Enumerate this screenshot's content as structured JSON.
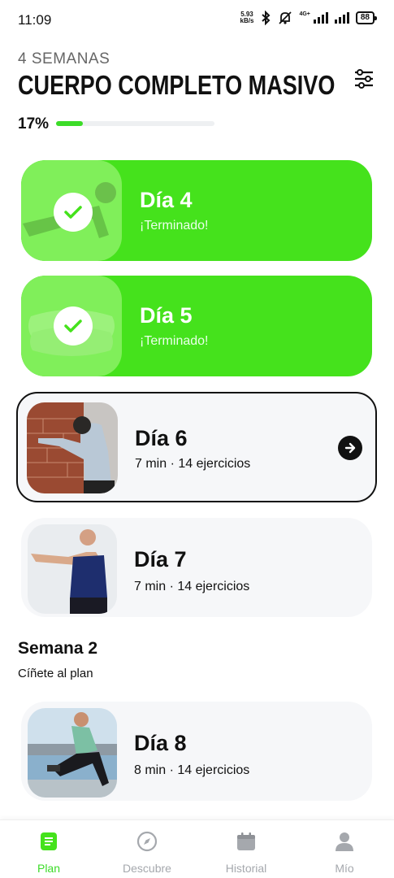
{
  "status_bar": {
    "time": "11:09",
    "net_speed_value": "5.93",
    "net_speed_unit": "kB/s",
    "network_type": "4G+",
    "battery": "88"
  },
  "header": {
    "weeks_label": "4 SEMANAS",
    "title": "CUERPO COMPLETO MASIVO",
    "progress_text": "17%",
    "progress_value": 0.17,
    "filter_icon": "sliders-icon"
  },
  "days": [
    {
      "label": "Día 4",
      "status": "¡Terminado!"
    },
    {
      "label": "Día 5",
      "status": "¡Terminado!"
    },
    {
      "label": "Día 6",
      "details": "7 min · 14 ejercicios"
    },
    {
      "label": "Día 7",
      "details": "7 min · 14 ejercicios"
    }
  ],
  "week2": {
    "title": "Semana 2",
    "subtitle": "Cíñete al plan",
    "days": [
      {
        "label": "Día 8",
        "details": "8 min · 14 ejercicios"
      }
    ]
  },
  "nav": {
    "items": [
      {
        "label": "Plan",
        "icon": "plan-icon",
        "active": true
      },
      {
        "label": "Descubre",
        "icon": "compass-icon"
      },
      {
        "label": "Historial",
        "icon": "calendar-icon"
      },
      {
        "label": "Mío",
        "icon": "person-icon"
      }
    ]
  },
  "colors": {
    "accent": "#45e21c",
    "accent_light": "#80ef5a",
    "nav_inactive": "#a5a8ad"
  }
}
